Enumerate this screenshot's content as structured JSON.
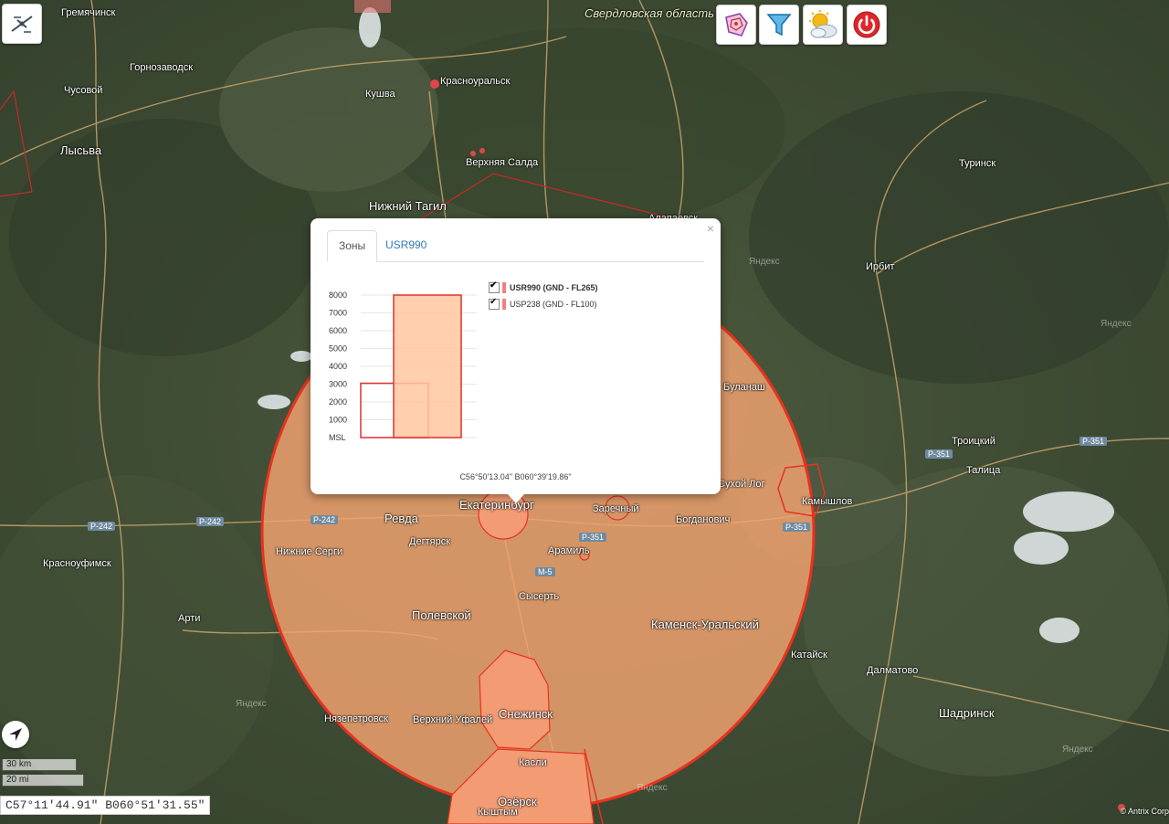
{
  "region_label": "Свердловская область",
  "cities": [
    {
      "name": "Гремячинск",
      "size": "small"
    },
    {
      "name": "Горнозаводск",
      "size": "small"
    },
    {
      "name": "Чусовой",
      "size": "small"
    },
    {
      "name": "Лысьва",
      "size": "big"
    },
    {
      "name": "Кушва",
      "size": "small"
    },
    {
      "name": "Красноуральск",
      "size": "small"
    },
    {
      "name": "Верхняя Салда",
      "size": "small"
    },
    {
      "name": "Нижний Тагил",
      "size": "big"
    },
    {
      "name": "Алапаевск",
      "size": "small"
    },
    {
      "name": "Туринск",
      "size": "small"
    },
    {
      "name": "Ирбит",
      "size": "small"
    },
    {
      "name": "Буланаш",
      "size": "small"
    },
    {
      "name": "Троицкий",
      "size": "small"
    },
    {
      "name": "Талица",
      "size": "small"
    },
    {
      "name": "Сухой Лог",
      "size": "small"
    },
    {
      "name": "Камышлов",
      "size": "small"
    },
    {
      "name": "Ревда",
      "size": "big"
    },
    {
      "name": "Екатеринбург",
      "size": "big"
    },
    {
      "name": "Заречный",
      "size": "small"
    },
    {
      "name": "Богданович",
      "size": "small"
    },
    {
      "name": "Дегтярск",
      "size": "small"
    },
    {
      "name": "Арамиль",
      "size": "small"
    },
    {
      "name": "Нижние Серги",
      "size": "small"
    },
    {
      "name": "Красноуфимск",
      "size": "small"
    },
    {
      "name": "Сысерть",
      "size": "small"
    },
    {
      "name": "Полевской",
      "size": "big"
    },
    {
      "name": "Арти",
      "size": "small"
    },
    {
      "name": "Каменск-Уральский",
      "size": "big"
    },
    {
      "name": "Катайск",
      "size": "small"
    },
    {
      "name": "Далматово",
      "size": "small"
    },
    {
      "name": "Нязепетровск",
      "size": "small"
    },
    {
      "name": "Верхний Уфалей",
      "size": "small"
    },
    {
      "name": "Снежинск",
      "size": "big"
    },
    {
      "name": "Шадринск",
      "size": "big"
    },
    {
      "name": "Касли",
      "size": "small"
    },
    {
      "name": "Озёрск",
      "size": "big"
    },
    {
      "name": "Кыштым",
      "size": "small"
    }
  ],
  "roads": [
    "Р-242",
    "Р-242",
    "Р-242",
    "Р-351",
    "Р-351",
    "Р-351",
    "Р-351",
    "М-5"
  ],
  "watermarks": [
    "Яндекс",
    "Яндекс",
    "Яндекс",
    "Яндекс",
    "Яндекс"
  ],
  "toolbar": {
    "buttons": [
      {
        "name": "zones-tool-button",
        "icon": "polygon-zones-icon"
      },
      {
        "name": "filter-button",
        "icon": "funnel-icon"
      },
      {
        "name": "weather-button",
        "icon": "weather-icon"
      },
      {
        "name": "power-button",
        "icon": "power-icon"
      }
    ],
    "logo_icon": "drone-icon"
  },
  "scale": {
    "metric": "30 km",
    "imperial": "20 mi"
  },
  "cursor_coords": "С57°11'44.91\" В060°51'31.55\"",
  "attribution": "© Antrix Corp",
  "colors": {
    "zone_fill": "#f4a470",
    "zone_border": "#e8321f",
    "chart_border": "#e03030",
    "chart_fill": "#ffc7a0",
    "tab_link": "#337ab7"
  },
  "popup": {
    "close": "×",
    "tabs": [
      {
        "label": "Зоны",
        "active": true
      },
      {
        "label": "USR990",
        "active": false
      }
    ],
    "coords": "С56°50'13.04\" В060°39'19.86\"",
    "legend": [
      {
        "label": "USR990 (GND - FL265)",
        "checked": true,
        "bold": true
      },
      {
        "label": "USP238 (GND - FL100)",
        "checked": true,
        "bold": false
      }
    ]
  },
  "chart_data": {
    "type": "bar",
    "y_ticks": [
      "8000",
      "7000",
      "6000",
      "5000",
      "4000",
      "3000",
      "2000",
      "1000",
      "MSL"
    ],
    "ylim": [
      0,
      8000
    ],
    "series": [
      {
        "name": "USP238 (GND - FL100)",
        "bottom": 0,
        "top": 3050,
        "filled": false
      },
      {
        "name": "USR990 (GND - FL265)",
        "bottom": 0,
        "top": 8000,
        "filled": true
      }
    ]
  }
}
